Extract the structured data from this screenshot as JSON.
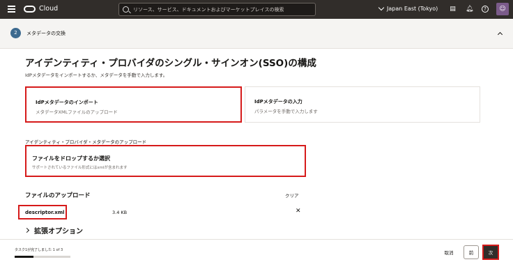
{
  "topbar": {
    "app_name": "Cloud",
    "search_placeholder": "リソース、サービス、ドキュメントおよびマーケットプレイスの検索",
    "region": "Japan East (Tokyo)"
  },
  "step": {
    "number": "2",
    "title": "メタデータの交換"
  },
  "main": {
    "title": "アイデンティティ・プロバイダのシングル・サインオン(SSO)の構成",
    "subtitle": "IdPメタデータをインポートするか、メタデータを手動で入力します。",
    "tiles": [
      {
        "title": "IdPメタデータのインポート",
        "desc": "メタデータXMLファイルのアップロード"
      },
      {
        "title": "IdPメタデータの入力",
        "desc": "パラメータを手動で入力します"
      }
    ],
    "upload_label": "アイデンティティ・プロバイダ・メタデータのアップロード",
    "dropzone": {
      "title": "ファイルをドロップするか選択",
      "desc": "サポートされているファイル形式にはxmlが含まれます"
    },
    "file_section_title": "ファイルのアップロード",
    "clear_label": "クリア",
    "file": {
      "name": "descriptor.xml",
      "size": "3.4 KB",
      "remove": "✕"
    },
    "advanced_label": "拡張オプション"
  },
  "footer": {
    "progress_text": "タスク1が完了しました 1 of 3",
    "progress_fraction": 0.3333,
    "cancel_label": "取消",
    "prev_label": "前",
    "next_label": "次"
  }
}
